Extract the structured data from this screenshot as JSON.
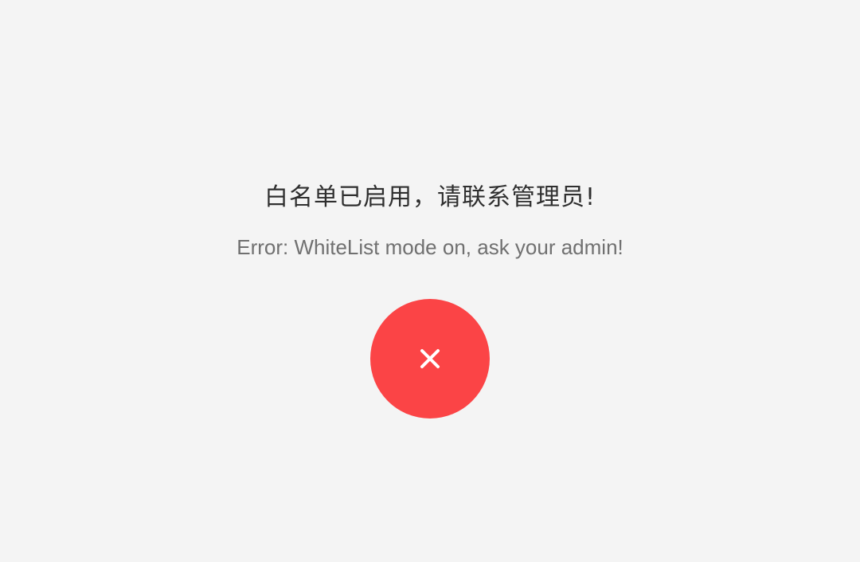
{
  "message": {
    "title": "白名单已启用，请联系管理员!",
    "detail": "Error: WhiteList mode on, ask your admin!"
  },
  "status_icon": {
    "name": "close-icon",
    "circle_color": "#fb4446",
    "glyph_color": "#ffffff"
  },
  "colors": {
    "background": "#f4f4f4",
    "title_text": "#2f2f2f",
    "detail_text": "#707070"
  }
}
